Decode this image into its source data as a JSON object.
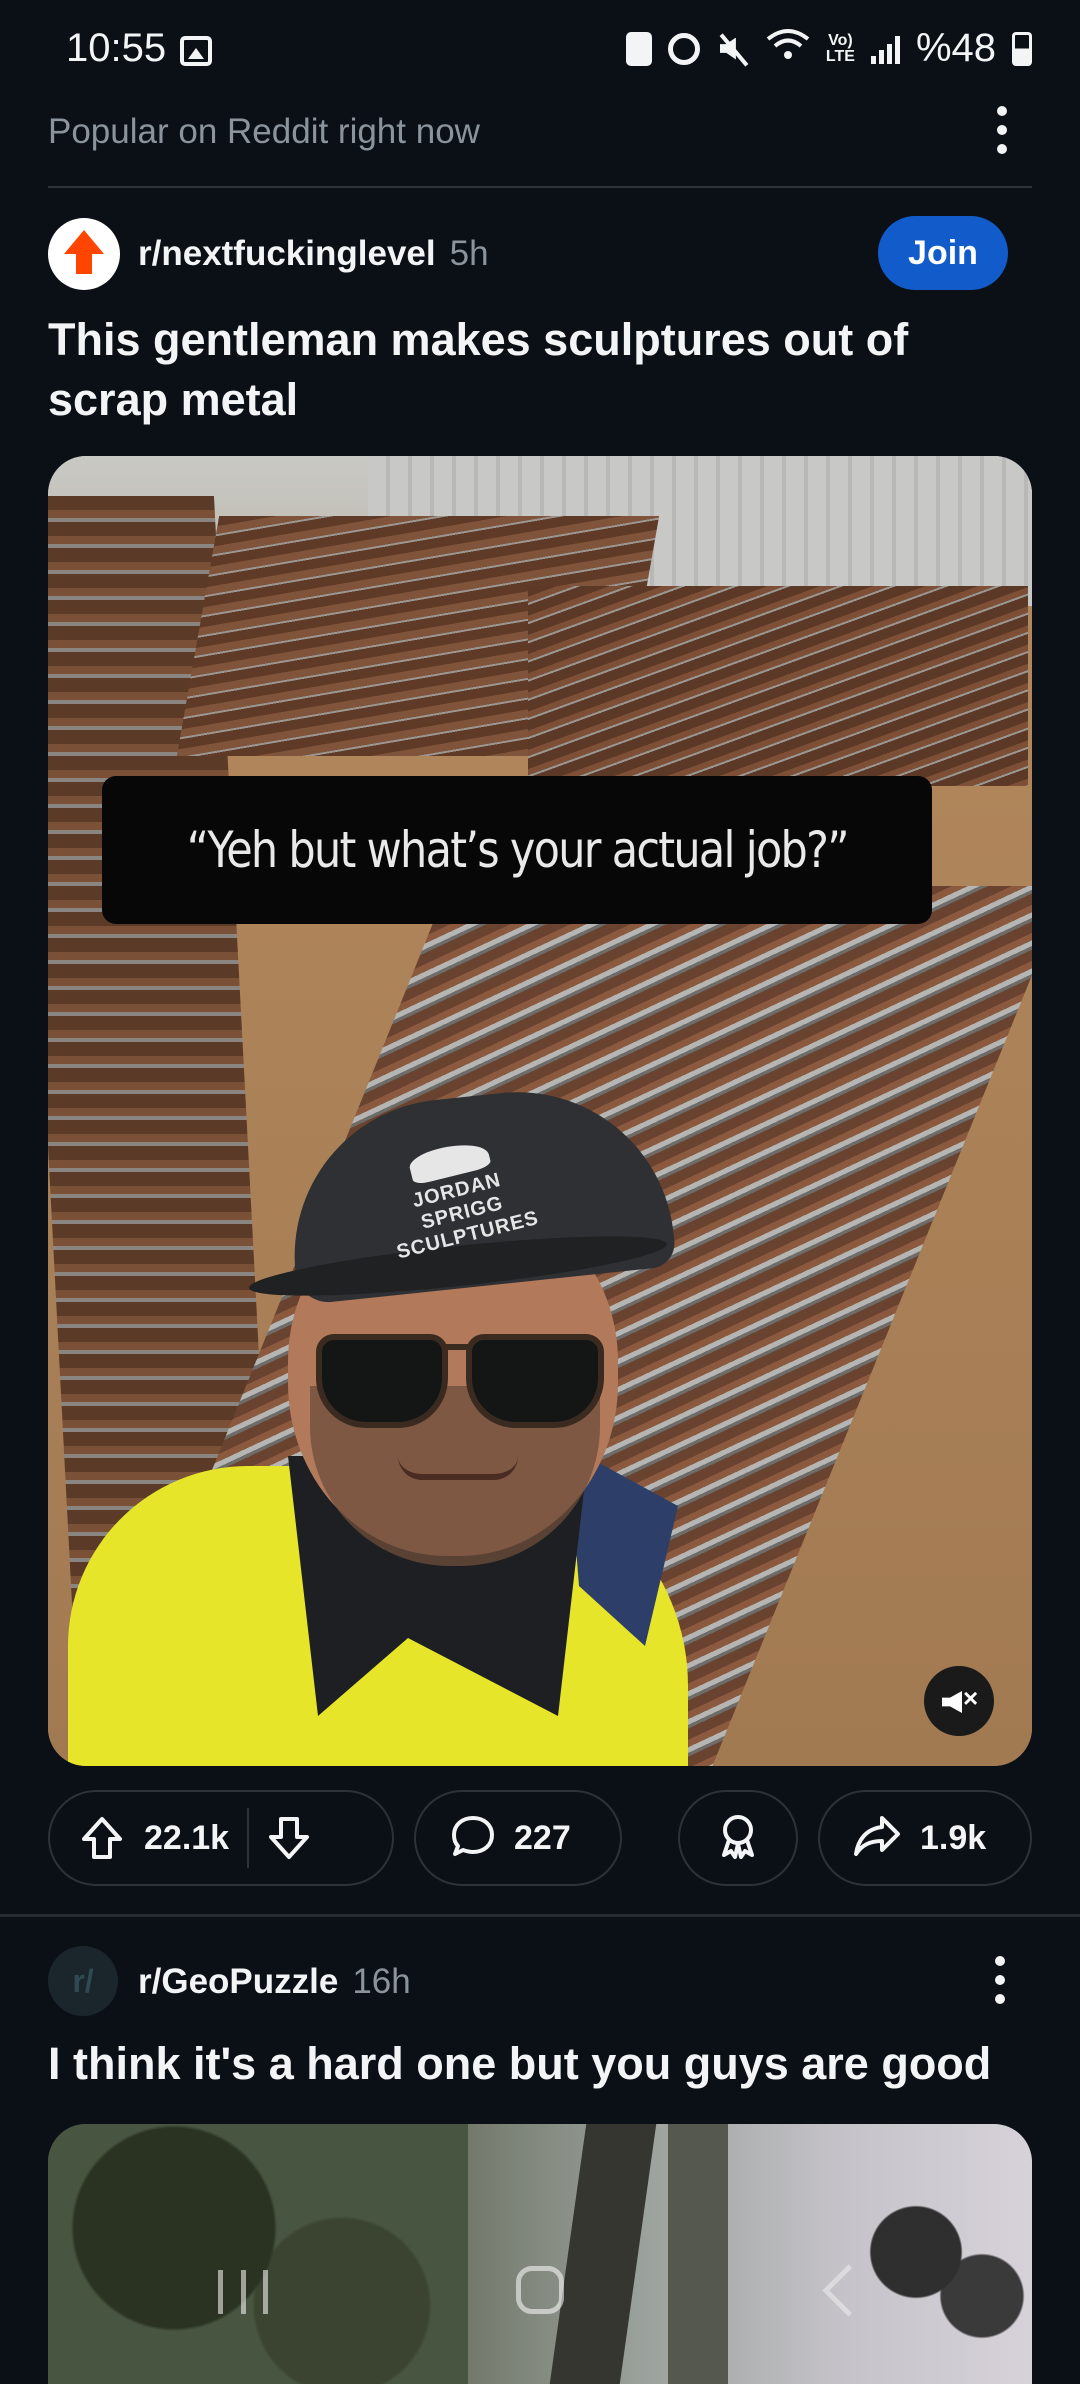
{
  "status_bar": {
    "time": "10:55",
    "battery_pct": "%48",
    "network": "LTE",
    "icons": [
      "image-icon",
      "sync-icon",
      "alarm-icon",
      "mute-icon",
      "wifi-icon",
      "volte-icon",
      "signal-icon",
      "battery-icon"
    ]
  },
  "feed_header": {
    "title": "Popular on Reddit right now"
  },
  "post1": {
    "subreddit": "r/nextfuckinglevel",
    "age": "5h",
    "join_label": "Join",
    "title": "This gentleman makes sculptures out of scrap metal",
    "caption": "“Yeh but what’s your actual job?”",
    "cap_logo": "JORDAN SPRIGG SCULPTURES",
    "upvotes": "22.1k",
    "comments": "227",
    "shares": "1.9k"
  },
  "post2": {
    "avatar_text": "r/",
    "subreddit": "r/GeoPuzzle",
    "age": "16h",
    "title": "I think it's a hard one but you guys are good"
  },
  "colors": {
    "background": "#0b1016",
    "join_button": "#115bca",
    "reddit_orange": "#ff4500",
    "muted_text": "#8b949c"
  }
}
